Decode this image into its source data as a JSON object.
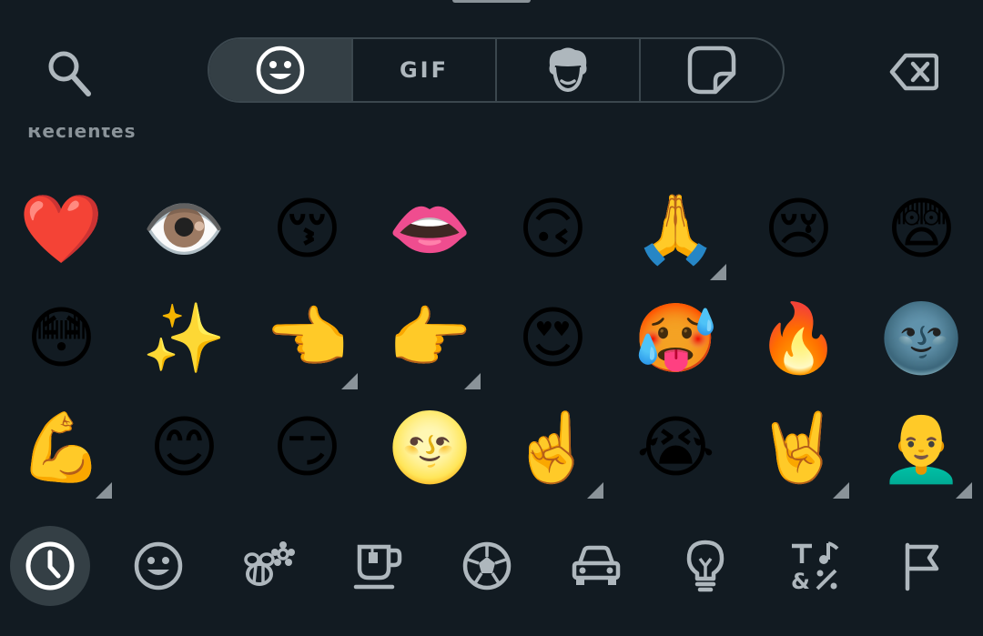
{
  "section": {
    "title": "Recientes"
  },
  "tabs": [
    {
      "name": "emoji"
    },
    {
      "name": "gif",
      "label": "GIF"
    },
    {
      "name": "avatar"
    },
    {
      "name": "sticker"
    }
  ],
  "emoji_rows": [
    [
      "❤️",
      "👁️",
      "😚",
      "👄",
      "🙃",
      "🙏",
      "😢",
      "😨"
    ],
    [
      "😳",
      "✨",
      "👈",
      "👉",
      "😍",
      "🥵",
      "🔥",
      "🌚"
    ],
    [
      "💪",
      "😊",
      "😏",
      "🌝",
      "☝️",
      "😭",
      "🤘",
      "👨‍🦲"
    ]
  ],
  "categories": [
    {
      "name": "recent",
      "icon": "clock-icon"
    },
    {
      "name": "smileys",
      "icon": "smiley-icon"
    },
    {
      "name": "animals-nature",
      "icon": "bee-flower-icon"
    },
    {
      "name": "food-drink",
      "icon": "coffee-cup-icon"
    },
    {
      "name": "activities",
      "icon": "soccer-ball-icon"
    },
    {
      "name": "travel-places",
      "icon": "car-icon"
    },
    {
      "name": "objects",
      "icon": "lightbulb-icon"
    },
    {
      "name": "symbols",
      "icon": "symbols-icon"
    },
    {
      "name": "flags",
      "icon": "flag-icon"
    }
  ],
  "colors": {
    "background": "#121b22",
    "icon": "#aeb7bd",
    "active_fill": "#343f45",
    "border": "#3b474e"
  }
}
